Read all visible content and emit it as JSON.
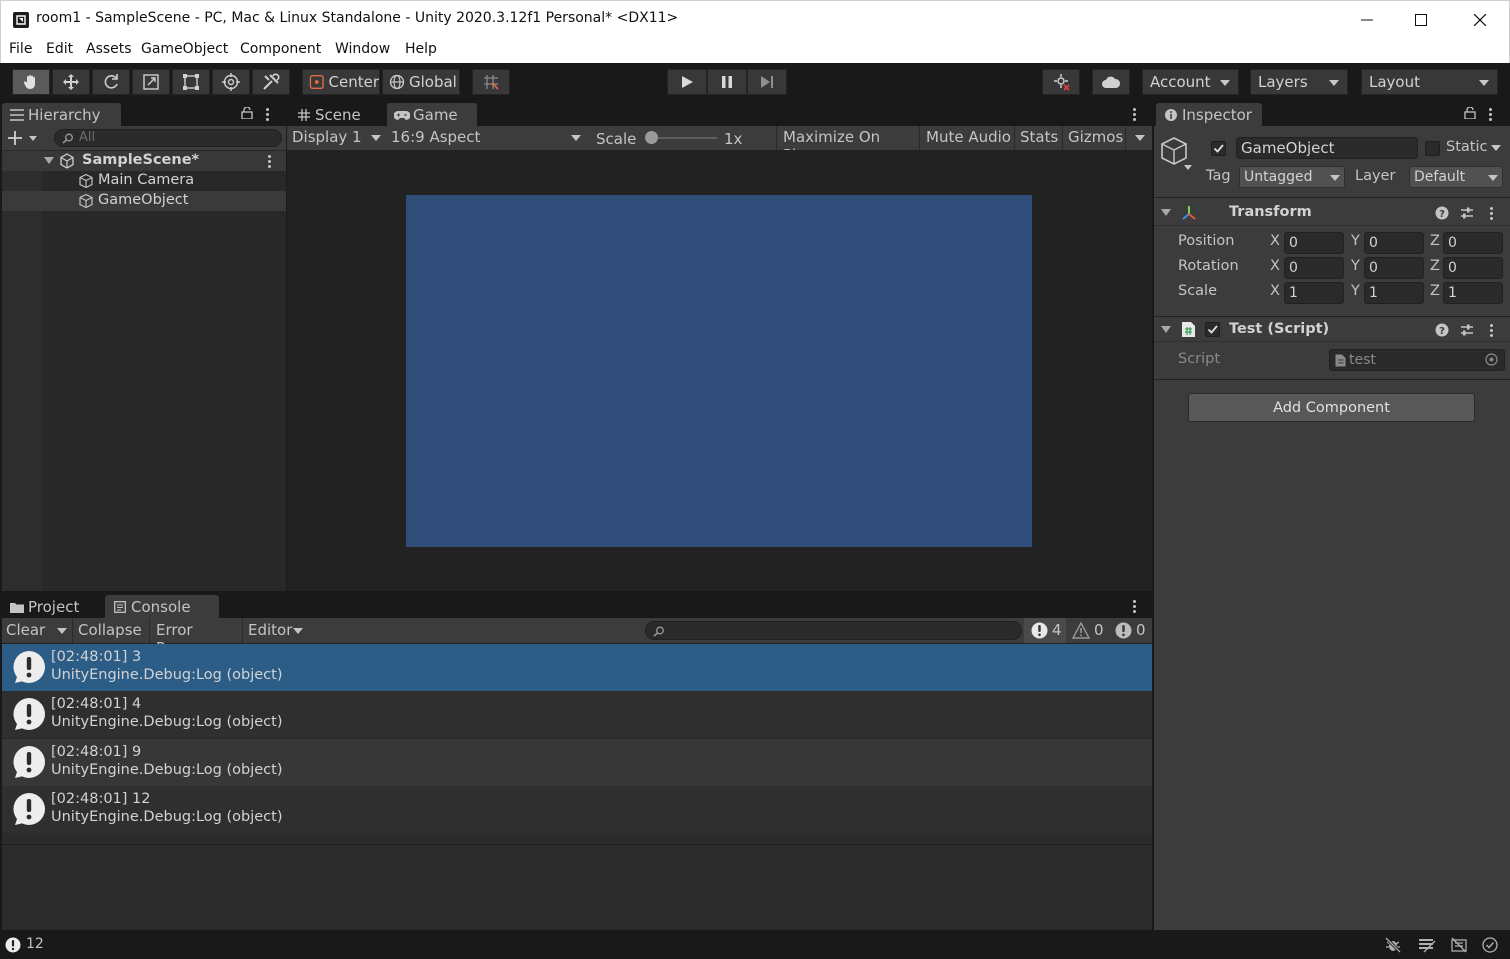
{
  "window": {
    "title": "room1 - SampleScene - PC, Mac & Linux Standalone - Unity 2020.3.12f1 Personal* <DX11>"
  },
  "menu": [
    "File",
    "Edit",
    "Assets",
    "GameObject",
    "Component",
    "Window",
    "Help"
  ],
  "toolbar": {
    "center_label": "Center",
    "global_label": "Global",
    "account_label": "Account",
    "layers_label": "Layers",
    "layout_label": "Layout"
  },
  "hierarchy": {
    "tab_label": "Hierarchy",
    "search_placeholder": "All",
    "scene_name": "SampleScene*",
    "items": [
      "Main Camera",
      "GameObject"
    ]
  },
  "game_view": {
    "tabs": [
      "Scene",
      "Game"
    ],
    "display": "Display 1",
    "aspect": "16:9 Aspect",
    "scale_label": "Scale",
    "scale_value": "1x",
    "maximize": "Maximize On Play",
    "mute": "Mute Audio",
    "stats": "Stats",
    "gizmos": "Gizmos",
    "background_color": "#314d79"
  },
  "inspector": {
    "tab_label": "Inspector",
    "object_name": "GameObject",
    "static_label": "Static",
    "tag_label": "Tag",
    "tag_value": "Untagged",
    "layer_label": "Layer",
    "layer_value": "Default",
    "transform": {
      "title": "Transform",
      "rows": [
        {
          "label": "Position",
          "x": "0",
          "y": "0",
          "z": "0"
        },
        {
          "label": "Rotation",
          "x": "0",
          "y": "0",
          "z": "0"
        },
        {
          "label": "Scale",
          "x": "1",
          "y": "1",
          "z": "1"
        }
      ],
      "axis_x": "X",
      "axis_y": "Y",
      "axis_z": "Z"
    },
    "script_component": {
      "title": "Test (Script)",
      "script_label": "Script",
      "script_value": "test"
    },
    "add_component": "Add Component"
  },
  "console": {
    "tabs": [
      "Project",
      "Console"
    ],
    "clear": "Clear",
    "collapse": "Collapse",
    "error_pause": "Error Pause",
    "editor": "Editor",
    "log_count": "4",
    "warn_count": "0",
    "error_count": "0",
    "entries": [
      {
        "line1": "[02:48:01] 3",
        "line2": "UnityEngine.Debug:Log (object)"
      },
      {
        "line1": "[02:48:01] 4",
        "line2": "UnityEngine.Debug:Log (object)"
      },
      {
        "line1": "[02:48:01] 9",
        "line2": "UnityEngine.Debug:Log (object)"
      },
      {
        "line1": "[02:48:01] 12",
        "line2": "UnityEngine.Debug:Log (object)"
      }
    ]
  },
  "statusbar": {
    "last_message": "12"
  }
}
